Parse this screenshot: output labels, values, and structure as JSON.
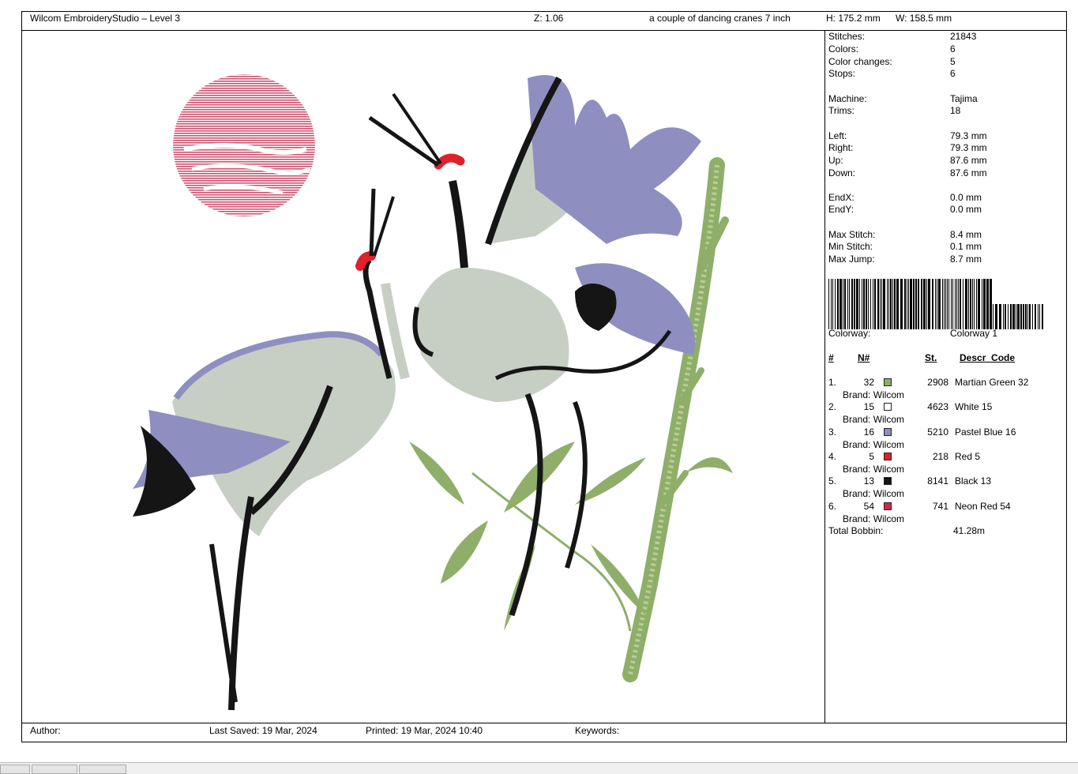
{
  "header": {
    "app_title": "Wilcom EmbroideryStudio – Level 3",
    "zoom": "Z: 1.06",
    "design_name": "a couple of dancing cranes 7 inch",
    "height": "H: 175.2 mm",
    "width": "W: 158.5 mm"
  },
  "stats": [
    {
      "label": "Stitches:",
      "value": "21843"
    },
    {
      "label": "Colors:",
      "value": "6"
    },
    {
      "label": "Color changes:",
      "value": "5"
    },
    {
      "label": "Stops:",
      "value": "6"
    },
    {
      "label": "Machine:",
      "value": "Tajima"
    },
    {
      "label": "Trims:",
      "value": "18"
    },
    {
      "label": "Left:",
      "value": "79.3 mm"
    },
    {
      "label": "Right:",
      "value": "79.3 mm"
    },
    {
      "label": "Up:",
      "value": "87.6 mm"
    },
    {
      "label": "Down:",
      "value": "87.6 mm"
    },
    {
      "label": "EndX:",
      "value": "0.0 mm"
    },
    {
      "label": "EndY:",
      "value": "0.0 mm"
    },
    {
      "label": "Max Stitch:",
      "value": "8.4 mm"
    },
    {
      "label": "Min Stitch:",
      "value": "0.1 mm"
    },
    {
      "label": "Max Jump:",
      "value": "8.7 mm"
    }
  ],
  "colorway": {
    "label": "Colorway:",
    "value": "Colorway 1"
  },
  "color_table": {
    "headers": {
      "num": "#",
      "n": "N#",
      "st": "St.",
      "descr": "Descr_Code"
    },
    "rows": [
      {
        "idx": "1.",
        "n": "32",
        "color": "#8fae6a",
        "st": "2908",
        "descr": "Martian Green 32",
        "brand": "Brand: Wilcom"
      },
      {
        "idx": "2.",
        "n": "15",
        "color": "#ffffff",
        "st": "4623",
        "descr": "White 15",
        "brand": "Brand: Wilcom"
      },
      {
        "idx": "3.",
        "n": "16",
        "color": "#8e8fc0",
        "st": "5210",
        "descr": "Pastel Blue 16",
        "brand": "Brand: Wilcom"
      },
      {
        "idx": "4.",
        "n": "5",
        "color": "#e0202a",
        "st": "218",
        "descr": "Red 5",
        "brand": "Brand: Wilcom"
      },
      {
        "idx": "5.",
        "n": "13",
        "color": "#151515",
        "st": "8141",
        "descr": "Black 13",
        "brand": "Brand: Wilcom"
      },
      {
        "idx": "6.",
        "n": "54",
        "color": "#d2284a",
        "st": "741",
        "descr": "Neon Red 54",
        "brand": "Brand: Wilcom"
      }
    ]
  },
  "total_bobbin": {
    "label": "Total Bobbin:",
    "value": "41.28m"
  },
  "footer": {
    "author": "Author:",
    "last_saved": "Last Saved: 19 Mar, 2024",
    "printed": "Printed: 19 Mar, 2024 10:40",
    "keywords": "Keywords:"
  },
  "colors": {
    "green": "#8fae6a",
    "grey_body": "#c7cfc4",
    "blue_wing": "#8e8fc0",
    "red_crown": "#e0202a",
    "black": "#151515",
    "sun": "#c94a6a"
  }
}
